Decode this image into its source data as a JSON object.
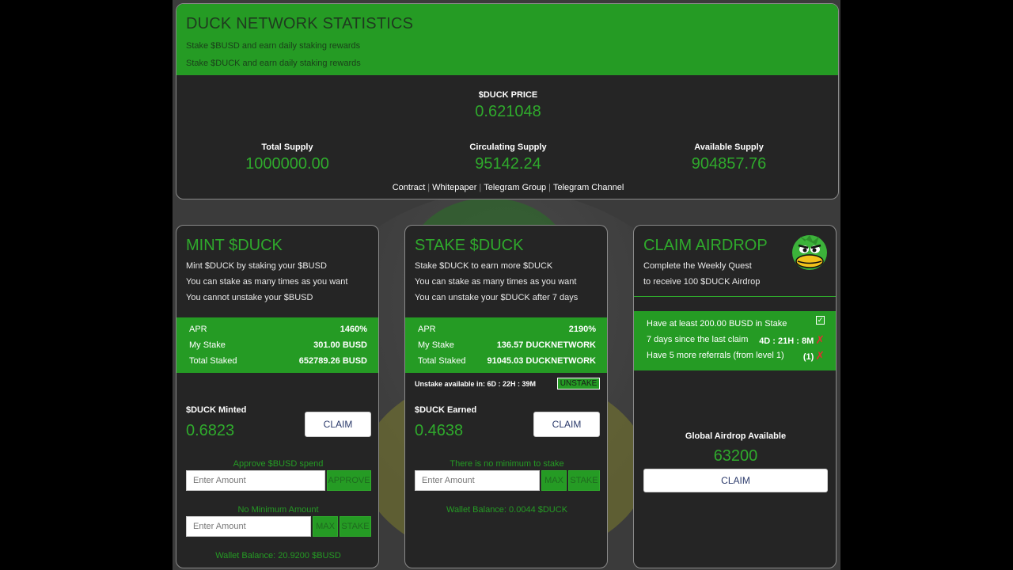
{
  "header": {
    "title": "DUCK NETWORK STATISTICS",
    "sub1": "Stake $BUSD and earn daily staking rewards",
    "sub2": "Stake $DUCK and earn daily staking rewards",
    "price_label": "$DUCK PRICE",
    "price_value": "0.621048",
    "total_supply_label": "Total Supply",
    "total_supply_value": "1000000.00",
    "circulating_label": "Circulating Supply",
    "circulating_value": "95142.24",
    "available_label": "Available Supply",
    "available_value": "904857.76",
    "links": [
      "Contract",
      "Whitepaper",
      "Telegram Group",
      "Telegram Channel"
    ]
  },
  "mint": {
    "title": "MINT $DUCK",
    "lines": [
      "Mint $DUCK by staking your $BUSD",
      "You can stake as many times as you want",
      "You cannot unstake your $BUSD"
    ],
    "stats": [
      {
        "label": "APR",
        "value": "1460%"
      },
      {
        "label": "My Stake",
        "value": "301.00 BUSD"
      },
      {
        "label": "Total Staked",
        "value": "652789.26 BUSD"
      }
    ],
    "minted_label": "$DUCK Minted",
    "minted_value": "0.6823",
    "claim_label": "CLAIM",
    "approve_note": "Approve $BUSD spend",
    "approve_placeholder": "Enter Amount",
    "approve_label": "APPROVE",
    "stake_note": "No Minimum Amount",
    "stake_placeholder": "Enter Amount",
    "max_label": "MAX",
    "stake_label": "STAKE",
    "wallet": "Wallet Balance: 20.9200 $BUSD"
  },
  "stake": {
    "title": "STAKE $DUCK",
    "lines": [
      "Stake $DUCK to earn more $DUCK",
      "You can stake as many times as you want",
      "You can unstake your $DUCK after 7 days"
    ],
    "stats": [
      {
        "label": "APR",
        "value": "2190%"
      },
      {
        "label": "My Stake",
        "value": "136.57 DUCKNETWORK"
      },
      {
        "label": "Total Staked",
        "value": "91045.03 DUCKNETWORK"
      }
    ],
    "unstake_info": "Unstake available in: 6D : 22H : 39M",
    "unstake_label": "UNSTAKE",
    "earned_label": "$DUCK Earned",
    "earned_value": "0.4638",
    "claim_label": "CLAIM",
    "stake_note": "There is no minimum to stake",
    "stake_placeholder": "Enter Amount",
    "max_label": "MAX",
    "stake_label": "STAKE",
    "wallet": "Wallet Balance: 0.0044 $DUCK"
  },
  "airdrop": {
    "title": "CLAIM AIRDROP",
    "lines": [
      "Complete the Weekly Quest",
      "to receive 100 $DUCK Airdrop"
    ],
    "quests": [
      {
        "label": "Have at least 200.00 BUSD in Stake",
        "value": "",
        "status": "done"
      },
      {
        "label": "7 days since the last claim",
        "value": "4D : 21H : 8M",
        "status": "fail"
      },
      {
        "label": "Have 5 more referrals (from level 1)",
        "value": "(1)",
        "status": "fail"
      }
    ],
    "global_label": "Global Airdrop Available",
    "global_value": "63200",
    "claim_label": "CLAIM",
    "mascot_icon": "duck-mascot-icon"
  },
  "colors": {
    "accent": "#259b24",
    "accent_text": "#2faa2c",
    "card_bg": "#252525"
  }
}
